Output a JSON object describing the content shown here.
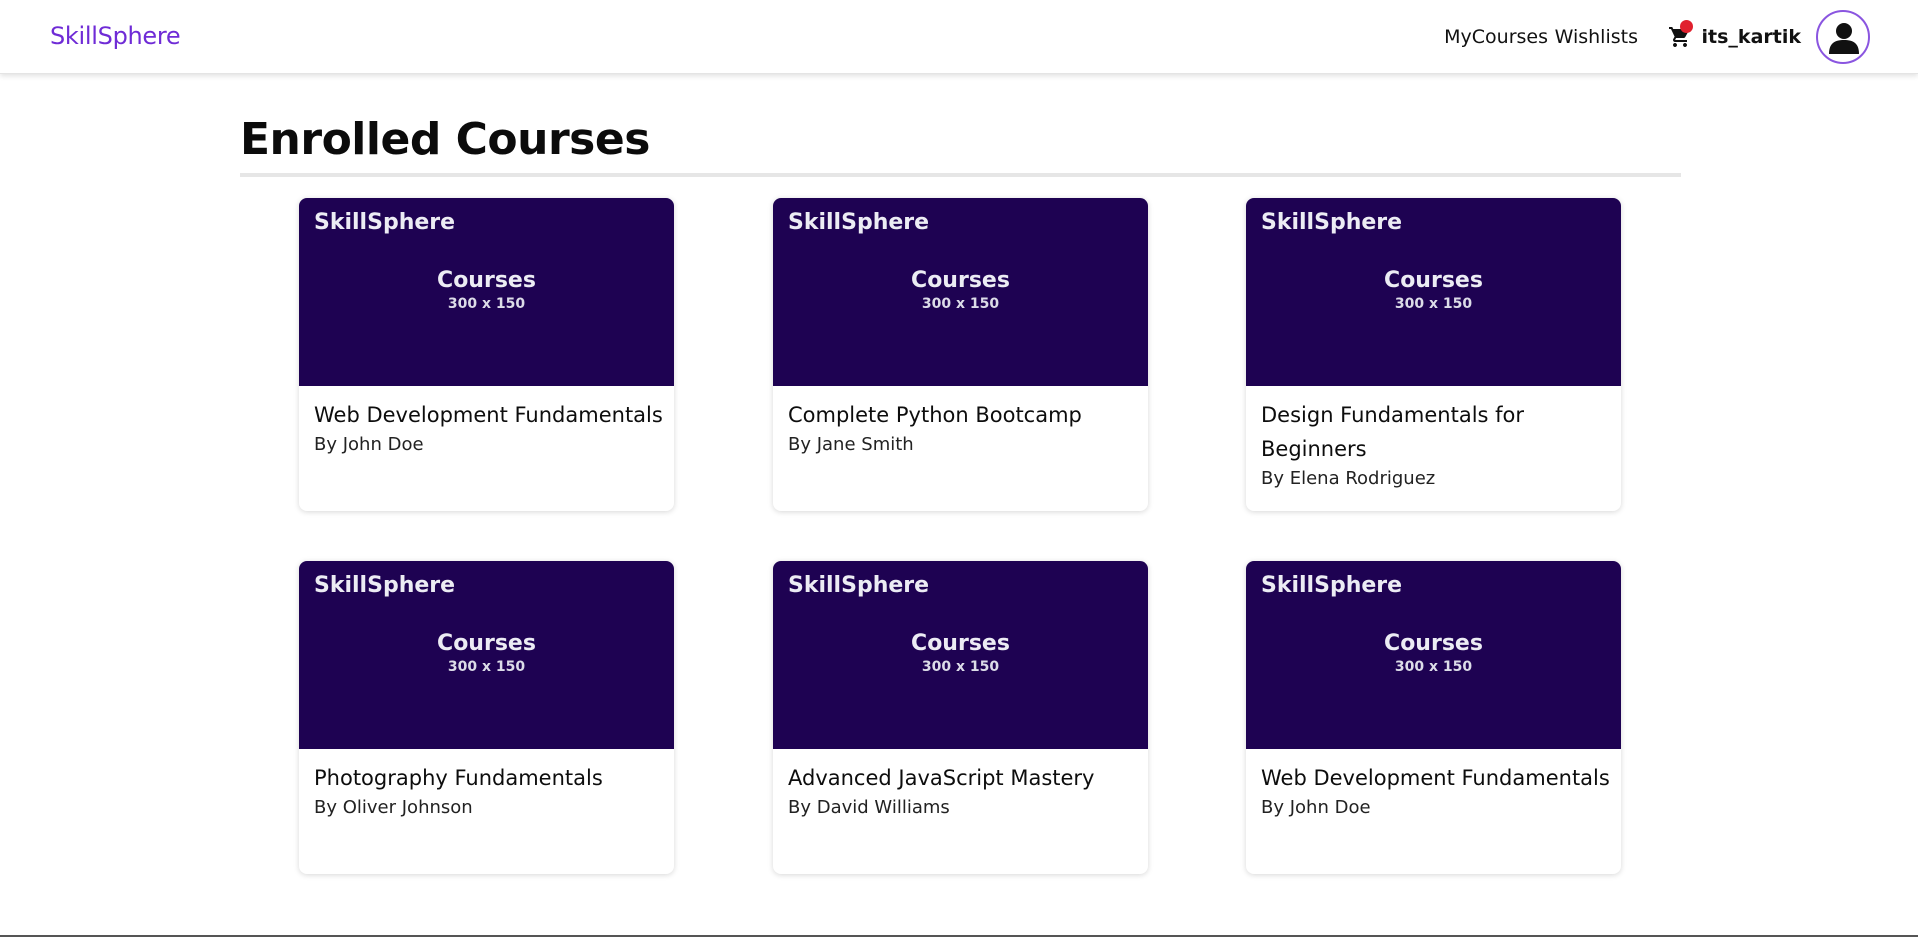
{
  "app": {
    "brand": "SkillSphere"
  },
  "nav": {
    "links": [
      "MyCourses",
      "Wishlists"
    ],
    "cart_icon": "shopping-cart-icon",
    "cart_badge_color": "#e0202e",
    "username": "its_kartik",
    "avatar_icon": "user-icon"
  },
  "page": {
    "title": "Enrolled Courses"
  },
  "thumbnail": {
    "brand": "SkillSphere",
    "label": "Courses",
    "size": "300 x 150",
    "background": "#1e0252"
  },
  "courses": [
    {
      "title": "Web Development Fundamentals",
      "author": "By John Doe"
    },
    {
      "title": "Complete Python Bootcamp",
      "author": "By Jane Smith"
    },
    {
      "title": "Design Fundamentals for Beginners",
      "author": "By Elena Rodriguez"
    },
    {
      "title": "Photography Fundamentals",
      "author": "By Oliver Johnson"
    },
    {
      "title": "Advanced JavaScript Mastery",
      "author": "By David Williams"
    },
    {
      "title": "Web Development Fundamentals",
      "author": "By John Doe"
    }
  ],
  "colors": {
    "accent": "#6f2bd6",
    "avatar_border": "#8a55e0"
  }
}
